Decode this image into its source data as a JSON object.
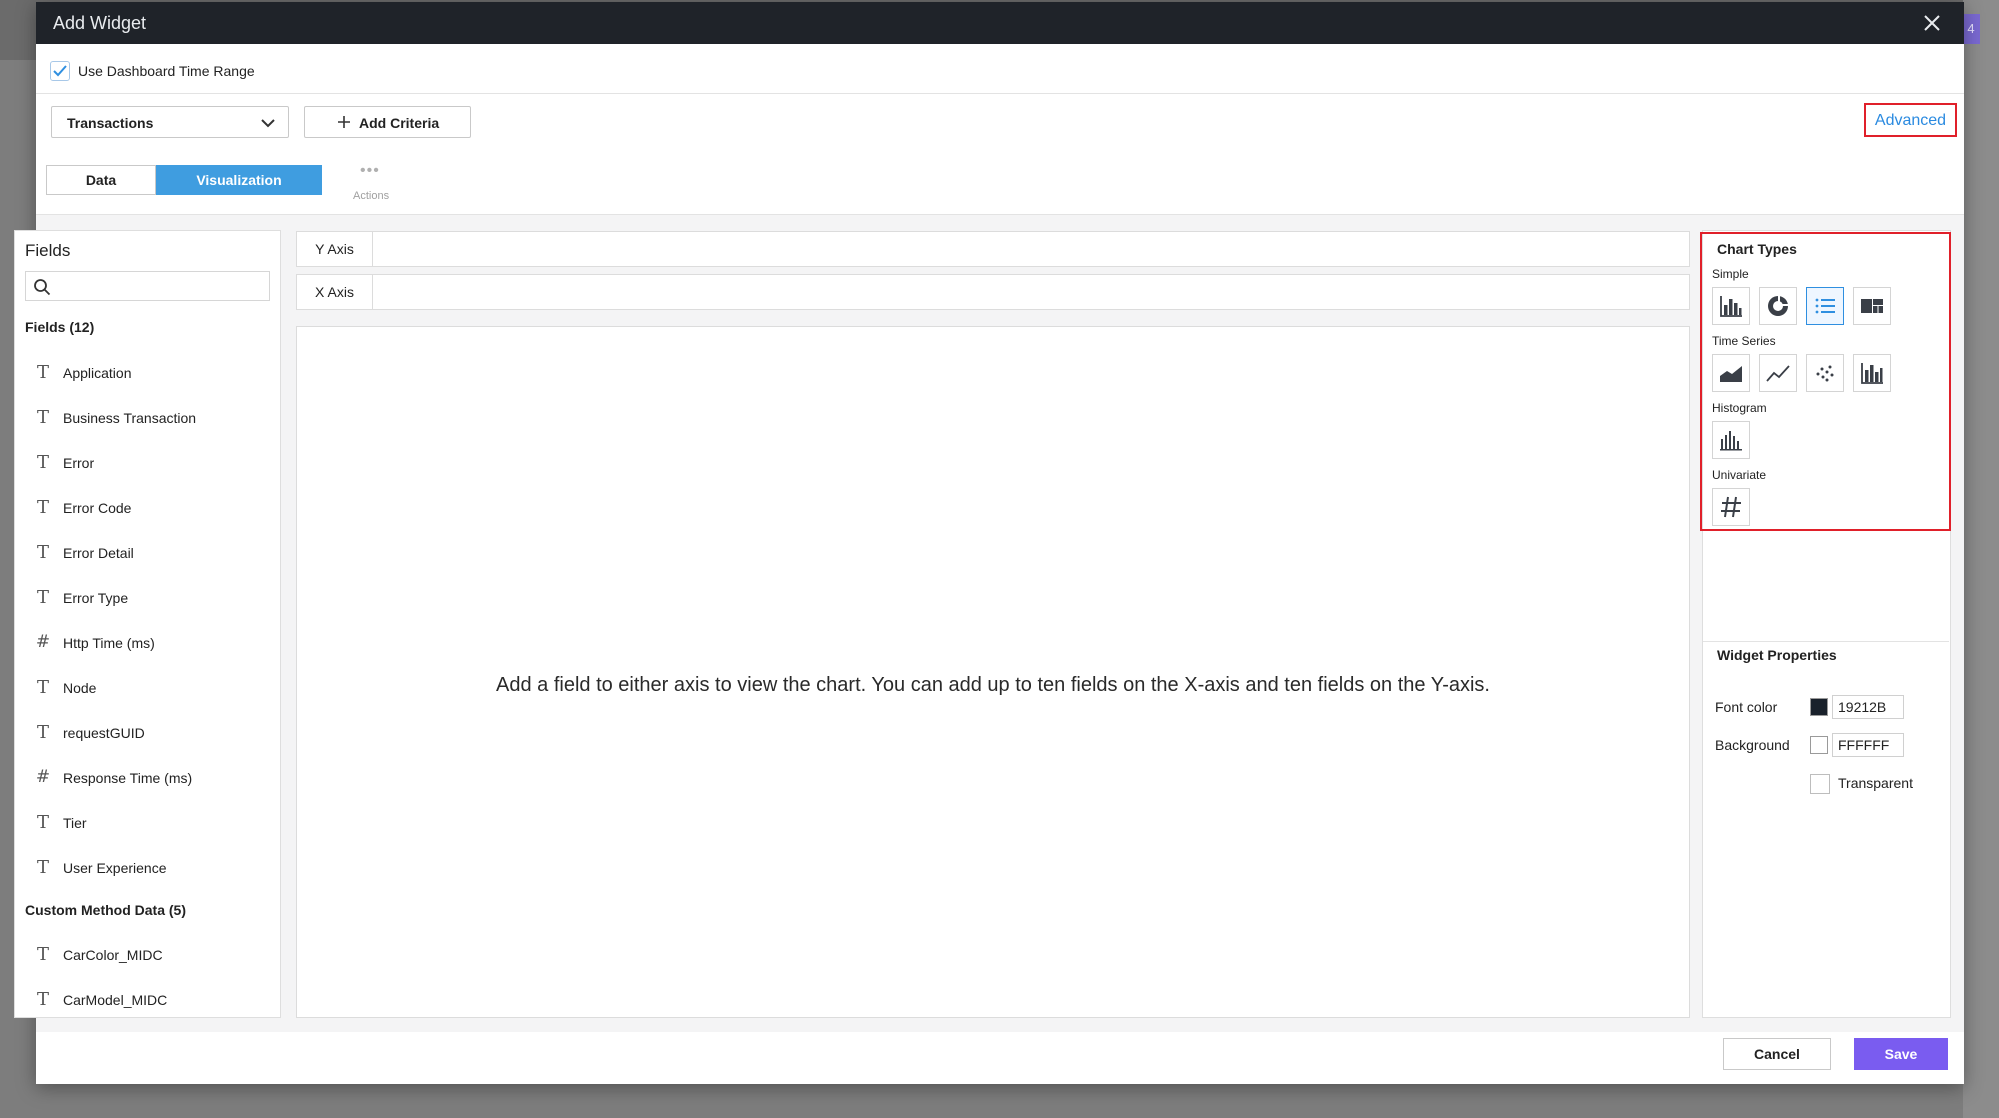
{
  "modal": {
    "title": "Add Widget"
  },
  "backdrop": {
    "badge": "4"
  },
  "time_range": {
    "label": "Use Dashboard Time Range",
    "checked": true
  },
  "toolbar": {
    "source": "Transactions",
    "add_criteria_label": "Add Criteria",
    "advanced_label": "Advanced"
  },
  "tabs": [
    {
      "label": "Data",
      "active": false
    },
    {
      "label": "Visualization",
      "active": true
    }
  ],
  "actions": {
    "label": "Actions"
  },
  "fields_panel": {
    "title": "Fields",
    "search_placeholder": "",
    "groups": [
      {
        "title": "Fields (12)",
        "items": [
          {
            "name": "Application",
            "type": "T"
          },
          {
            "name": "Business Transaction",
            "type": "T"
          },
          {
            "name": "Error",
            "type": "T"
          },
          {
            "name": "Error Code",
            "type": "T"
          },
          {
            "name": "Error Detail",
            "type": "T"
          },
          {
            "name": "Error Type",
            "type": "T"
          },
          {
            "name": "Http Time (ms)",
            "type": "#"
          },
          {
            "name": "Node",
            "type": "T"
          },
          {
            "name": "requestGUID",
            "type": "T"
          },
          {
            "name": "Response Time (ms)",
            "type": "#"
          },
          {
            "name": "Tier",
            "type": "T"
          },
          {
            "name": "User Experience",
            "type": "T"
          }
        ]
      },
      {
        "title": "Custom Method Data (5)",
        "items": [
          {
            "name": "CarColor_MIDC",
            "type": "T"
          },
          {
            "name": "CarModel_MIDC",
            "type": "T"
          }
        ]
      }
    ]
  },
  "axes": {
    "y_label": "Y Axis",
    "x_label": "X Axis"
  },
  "chart_area": {
    "message": "Add a field to either axis to view the chart. You can add up to ten fields on the X-axis and ten fields on the Y-axis."
  },
  "chart_types": {
    "title": "Chart Types",
    "groups": [
      {
        "label": "Simple",
        "types": [
          "bar-chart-icon",
          "donut-chart-icon",
          "list-chart-icon",
          "treemap-chart-icon"
        ],
        "selected": "list-chart-icon"
      },
      {
        "label": "Time Series",
        "types": [
          "area-chart-icon",
          "line-chart-icon",
          "scatter-chart-icon",
          "column-chart-icon"
        ]
      },
      {
        "label": "Histogram",
        "types": [
          "histogram-chart-icon"
        ]
      },
      {
        "label": "Univariate",
        "types": [
          "number-chart-icon"
        ]
      }
    ]
  },
  "widget_properties": {
    "title": "Widget Properties",
    "font_color_label": "Font color",
    "font_color": "19212B",
    "font_color_hex": "#19212B",
    "background_label": "Background",
    "background": "FFFFFF",
    "background_hex": "#FFFFFF",
    "transparent_label": "Transparent"
  },
  "footer": {
    "cancel_label": "Cancel",
    "save_label": "Save"
  },
  "colors": {
    "accent": "#3F9DE0",
    "primary_button": "#7A5CF0",
    "highlight_border": "#E0202A",
    "header_bg": "#1F2329"
  }
}
